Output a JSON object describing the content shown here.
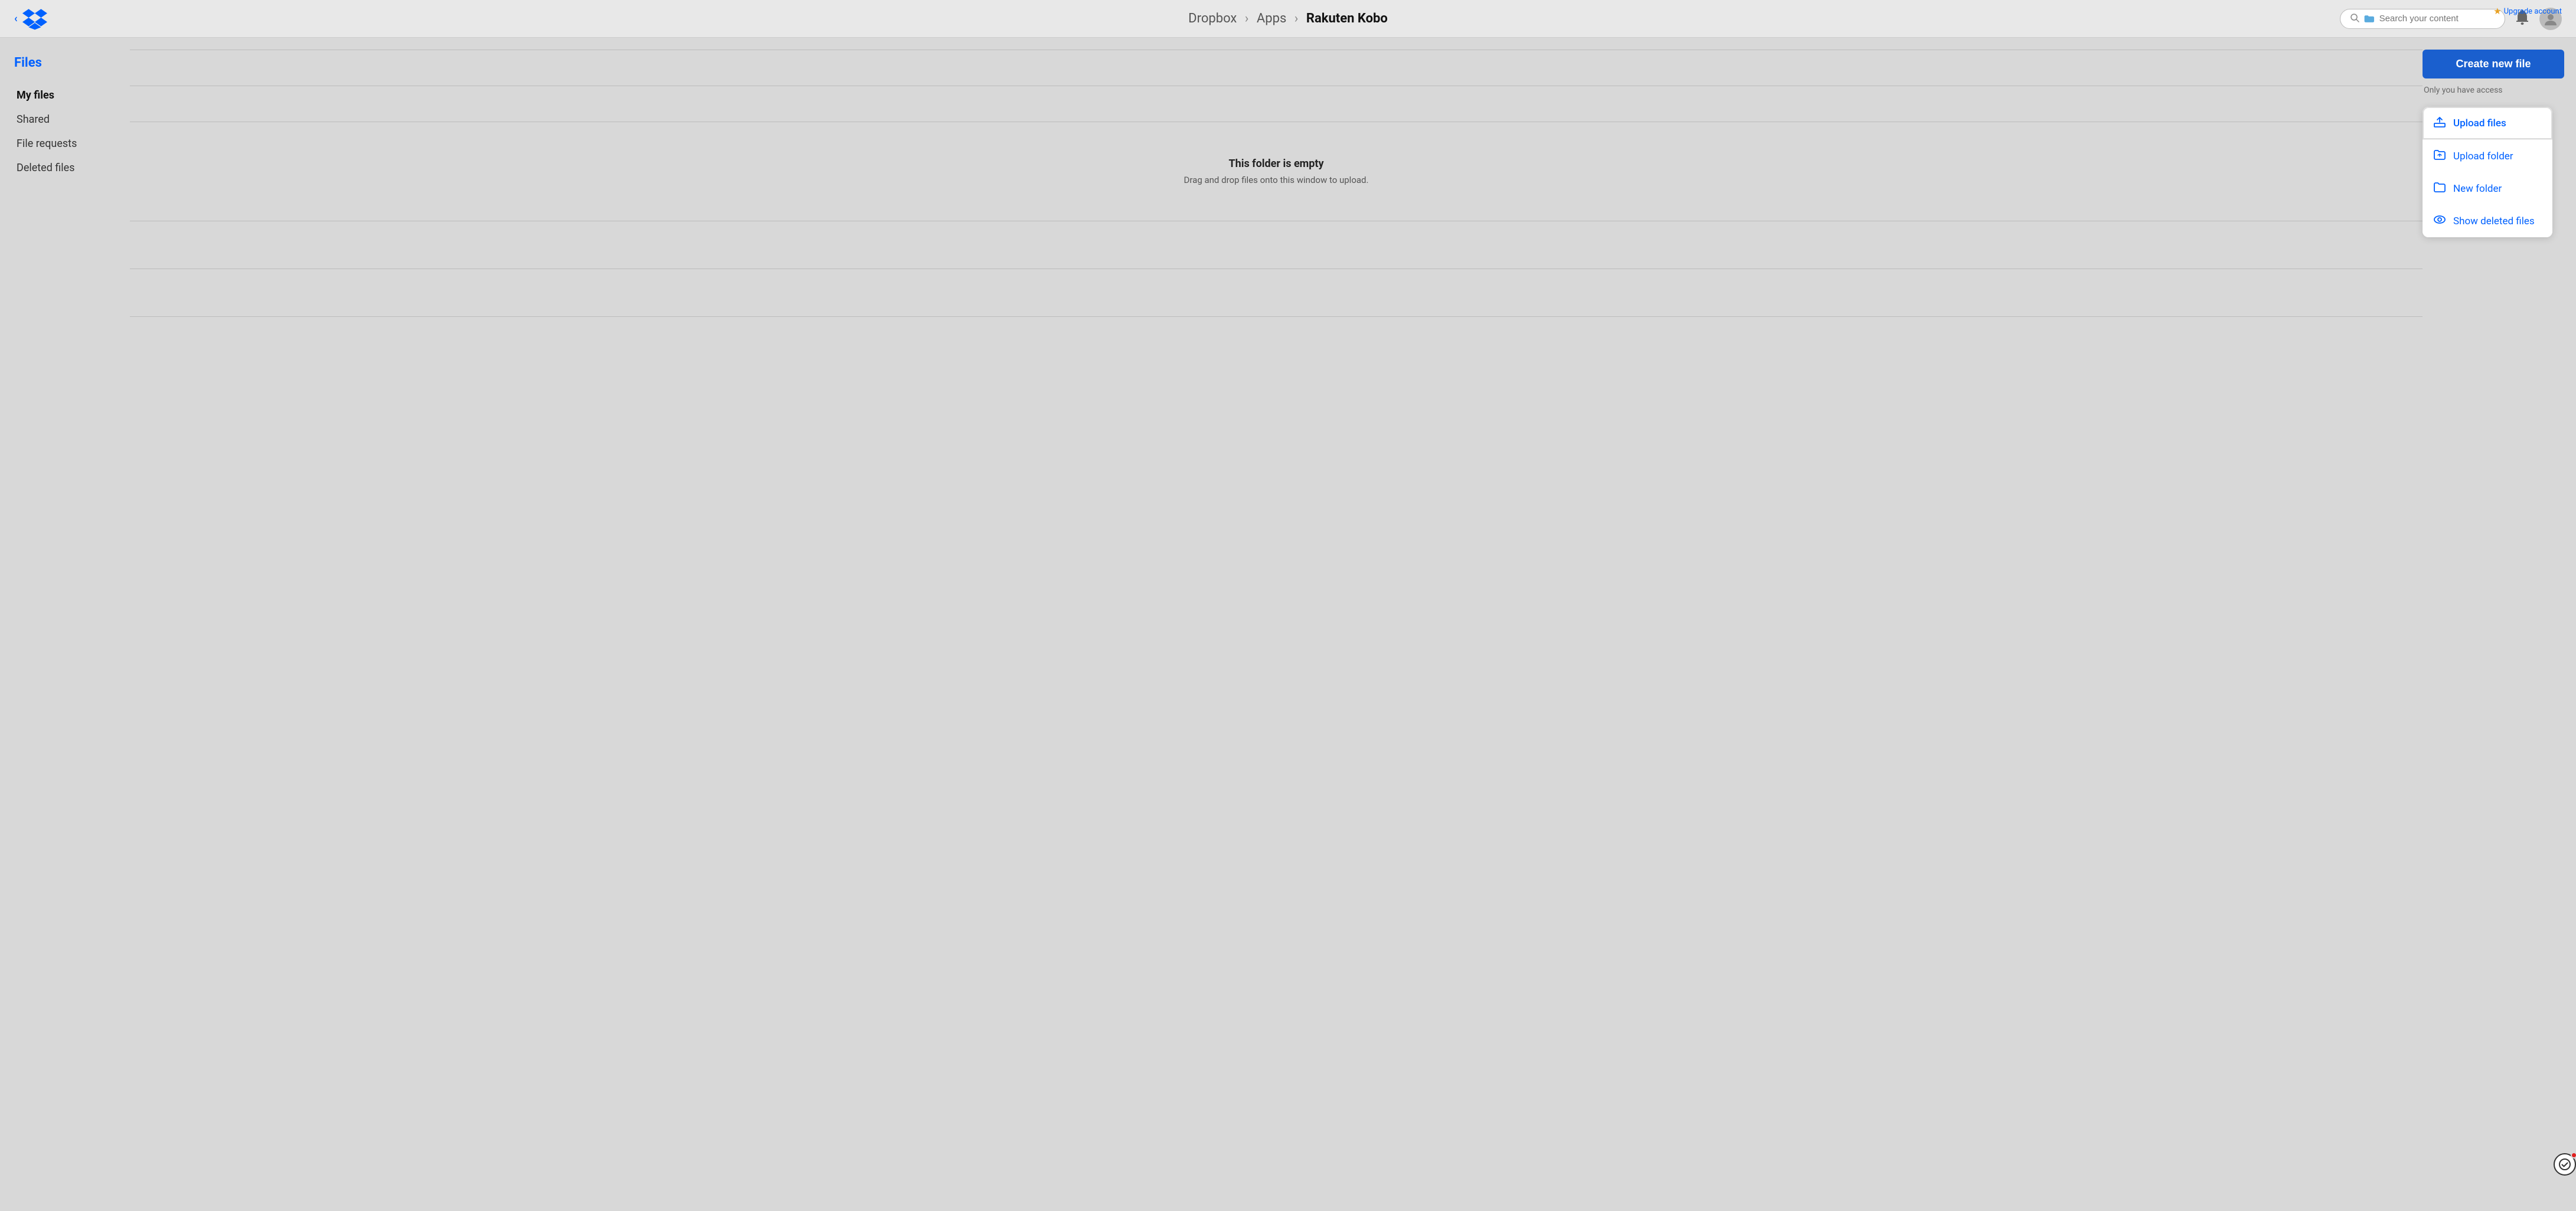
{
  "topbar": {
    "back_label": "‹",
    "breadcrumb": {
      "part1": "Dropbox",
      "sep1": "›",
      "part2": "Apps",
      "sep2": "›",
      "part3": "Rakuten Kobo"
    },
    "search_placeholder": "Search your content",
    "upgrade_label": "Upgrade account",
    "star_icon": "★"
  },
  "sidebar": {
    "heading": "Files",
    "nav_items": [
      {
        "id": "my-files",
        "label": "My files",
        "active": true
      },
      {
        "id": "shared",
        "label": "Shared",
        "active": false
      },
      {
        "id": "file-requests",
        "label": "File requests",
        "active": false
      },
      {
        "id": "deleted-files",
        "label": "Deleted files",
        "active": false
      }
    ]
  },
  "main": {
    "empty_title": "This folder is empty",
    "empty_subtitle": "Drag and drop files onto this window to upload."
  },
  "right_panel": {
    "create_btn_label": "Create new file",
    "access_text": "Only you have access",
    "dropdown": {
      "items": [
        {
          "id": "upload-files",
          "label": "Upload files",
          "icon": "upload"
        },
        {
          "id": "upload-folder",
          "label": "Upload folder",
          "icon": "upload-folder"
        },
        {
          "id": "new-folder",
          "label": "New folder",
          "icon": "new-folder"
        },
        {
          "id": "show-deleted",
          "label": "Show deleted files",
          "icon": "eye"
        }
      ]
    }
  }
}
